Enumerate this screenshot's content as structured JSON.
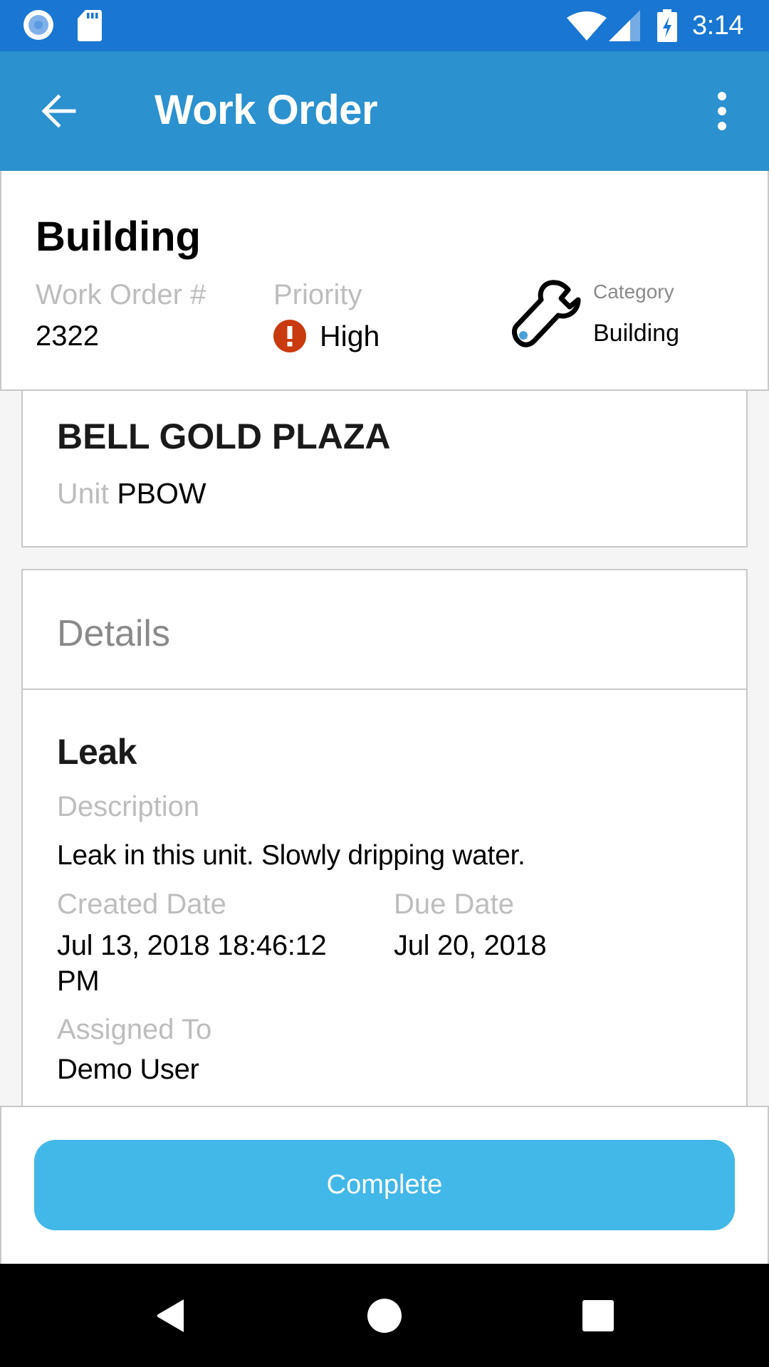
{
  "status_bar": {
    "time": "3:14",
    "icons": [
      "sync-circle-icon",
      "sd-card-icon",
      "wifi-icon",
      "signal-icon",
      "battery-charging-icon"
    ]
  },
  "app_bar": {
    "title": "Work Order",
    "back_icon": "arrow-left-icon",
    "menu_icon": "more-vert-icon"
  },
  "header": {
    "title": "Building",
    "work_order_label": "Work Order #",
    "work_order_number": "2322",
    "priority_label": "Priority",
    "priority_value": "High",
    "priority_icon": "alert-circle-icon",
    "priority_color": "#C93A0E",
    "category_label": "Category",
    "category_value": "Building",
    "category_icon": "wrench-icon"
  },
  "location": {
    "property_name": "BELL GOLD PLAZA",
    "unit_label": "Unit",
    "unit_value": "PBOW"
  },
  "details": {
    "section_title": "Details",
    "issue_title": "Leak",
    "description_label": "Description",
    "description_value": "Leak in this unit. Slowly dripping water.",
    "created_label": "Created Date",
    "created_value": "Jul 13, 2018 18:46:12 PM",
    "due_label": "Due Date",
    "due_value": "Jul 20, 2018",
    "assigned_label": "Assigned To",
    "assigned_value": "Demo User"
  },
  "actions": {
    "complete_label": "Complete",
    "button_color": "#41B8E8"
  },
  "nav_bar": {
    "buttons": [
      "back-triangle-icon",
      "home-circle-icon",
      "recents-square-icon"
    ]
  },
  "colors": {
    "status_bar": "#1976D2",
    "app_bar": "#2B91CF"
  }
}
